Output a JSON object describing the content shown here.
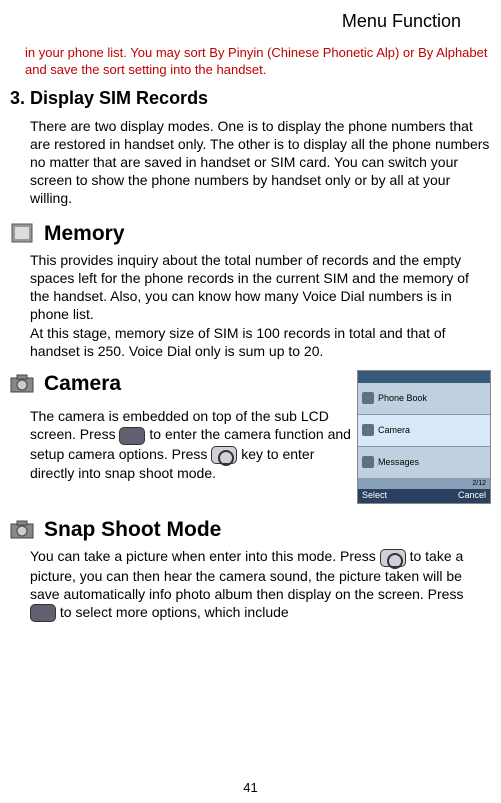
{
  "header": "Menu Function",
  "intro_red": "in your phone list. You may sort By Pinyin (Chinese Phonetic Alp) or By Alphabet and save the sort setting into the handset.",
  "section3": {
    "heading": "3. Display SIM Records",
    "body": "There are two display modes.     One is to display the phone numbers that are restored in handset only.     The other is to display all the phone numbers no matter that are saved in handset or SIM card.     You can switch your screen to show the phone numbers by handset only or by all at your willing."
  },
  "memory": {
    "title": "Memory",
    "body1": "This provides inquiry about the total number of records and the empty spaces left for the phone records in the current SIM and the memory of the handset. Also, you can know how many Voice Dial numbers is in phone list.",
    "body2": "At this stage, memory size of SIM is 100 records in total and that of handset is 250.    Voice Dial only is sum up to 20."
  },
  "camera": {
    "title": "Camera",
    "body_part1": "The camera is embedded on top of the sub LCD screen. Press ",
    "body_part2": " to enter the camera function and setup camera options. Press ",
    "body_part3": " key to enter directly into snap shoot mode."
  },
  "phone_screenshot": {
    "items": [
      "Phone Book",
      "Camera",
      "Messages"
    ],
    "indicator": "2/12",
    "left_soft": "Select",
    "right_soft": "Cancel"
  },
  "snap": {
    "title": "Snap Shoot Mode",
    "body_part1": "You can take a picture when enter into this mode. Press ",
    "body_part2": " to take a picture, you can then hear the camera sound, the picture taken will be save automatically info photo album then display on the screen. Press ",
    "body_part3": " to select more options, which include"
  },
  "page_number": "41"
}
